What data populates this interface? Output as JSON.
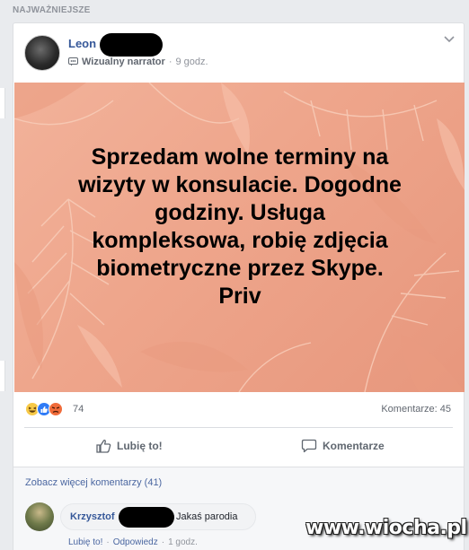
{
  "section_label": "NAJWAŻNIEJSZE",
  "post": {
    "author": "Leon",
    "narrator_label": "Wizualny narrator",
    "separator": "·",
    "time": "9 godz.",
    "image_text": "Sprzedam wolne terminy na\nwizyty w konsulacie. Dogodne\ngodziny. Usługa\nkompleksowa, robię zdjęcia\nbiometryczne przez Skype.\nPriv",
    "reaction_count": "74",
    "comments_count": "Komentarze: 45",
    "like_label": "Lubię to!",
    "comment_label": "Komentarze"
  },
  "comments": {
    "more_label": "Zobacz więcej komentarzy (41)",
    "items": [
      {
        "author": "Krzysztof",
        "text": "Jakaś parodia",
        "like": "Lubię to!",
        "reply": "Odpowiedz",
        "time": "1 godz."
      }
    ]
  },
  "watermark": "www.wiocha.pl",
  "icons": {
    "reaction_1": "haha-icon",
    "reaction_2": "like-icon",
    "reaction_3": "angry-icon"
  }
}
